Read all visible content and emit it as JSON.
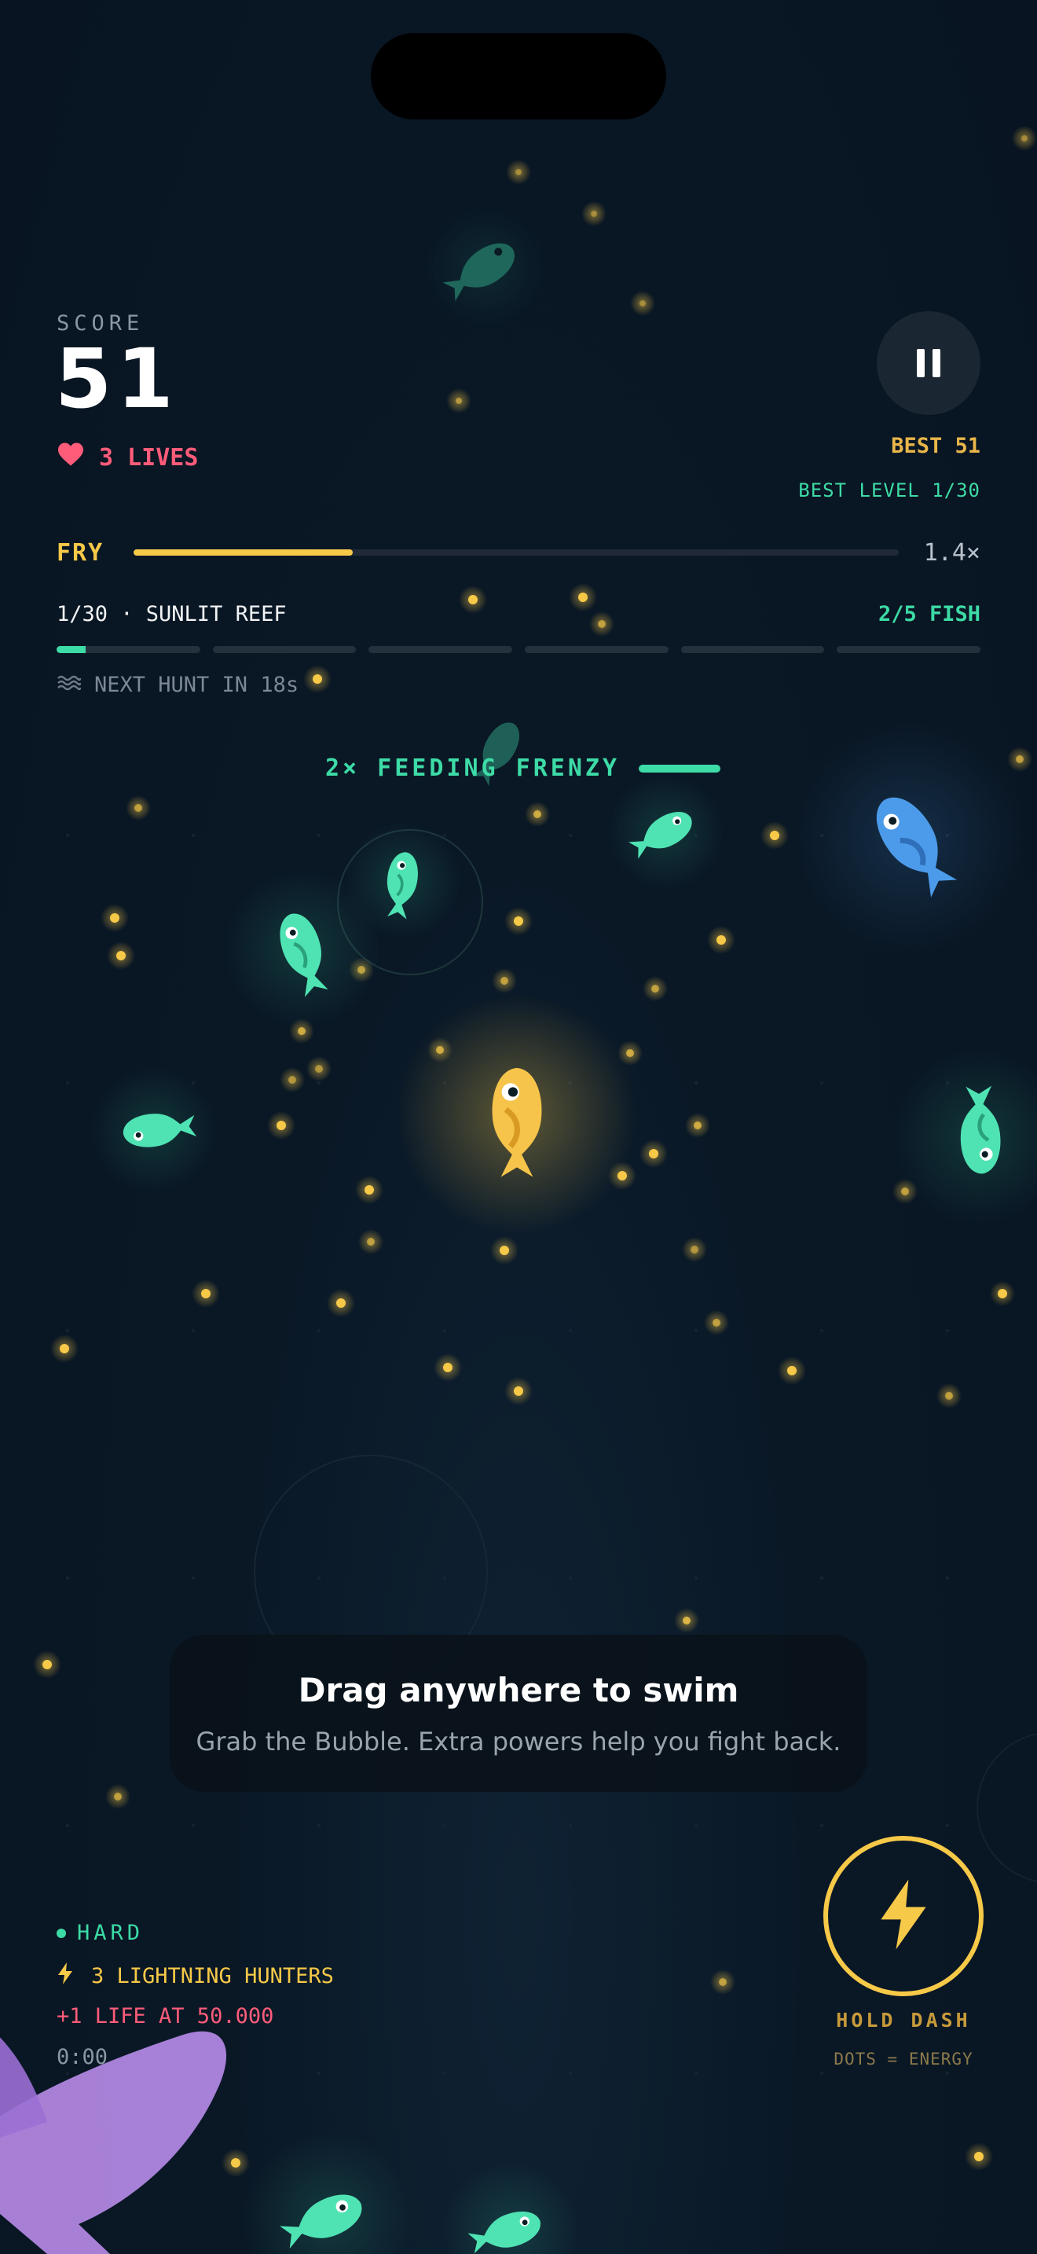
{
  "hud": {
    "score_label": "SCORE",
    "score": "51",
    "lives": "3 LIVES",
    "best": "BEST 51",
    "best_level": "BEST LEVEL 1/30"
  },
  "rank": {
    "name": "FRY",
    "progress": 0.286,
    "multiplier": "1.4×"
  },
  "level": {
    "label": "1/30 · SUNLIT REEF",
    "fish_count": "2/5 FISH",
    "segments": 6,
    "segment_progress": [
      0.2,
      0,
      0,
      0,
      0,
      0
    ],
    "next_hunt": "NEXT HUNT IN 18s"
  },
  "frenzy": {
    "label": "2× FEEDING FRENZY"
  },
  "hint": {
    "title": "Drag anywhere to swim",
    "subtitle": "Grab the Bubble. Extra powers help you fight back."
  },
  "status": {
    "difficulty": "HARD",
    "hunters": "3 LIGHTNING HUNTERS",
    "life_goal": "+1 LIFE AT 50.000",
    "timer": "0:00"
  },
  "dash": {
    "label": "HOLD DASH",
    "sub": "DOTS = ENERGY"
  },
  "colors": {
    "accent_teal": "#3ddba6",
    "accent_gold": "#f7c948",
    "lives_red": "#ff5c7a",
    "player_fish": "#f6c44a",
    "blue_fish": "#4c9bea",
    "predator": "#b58ae6"
  },
  "icons": {
    "lives": "heart-icon",
    "pause": "pause-icon",
    "next_hunt": "waves-icon",
    "hunters": "lightning-icon",
    "dash": "lightning-icon"
  }
}
